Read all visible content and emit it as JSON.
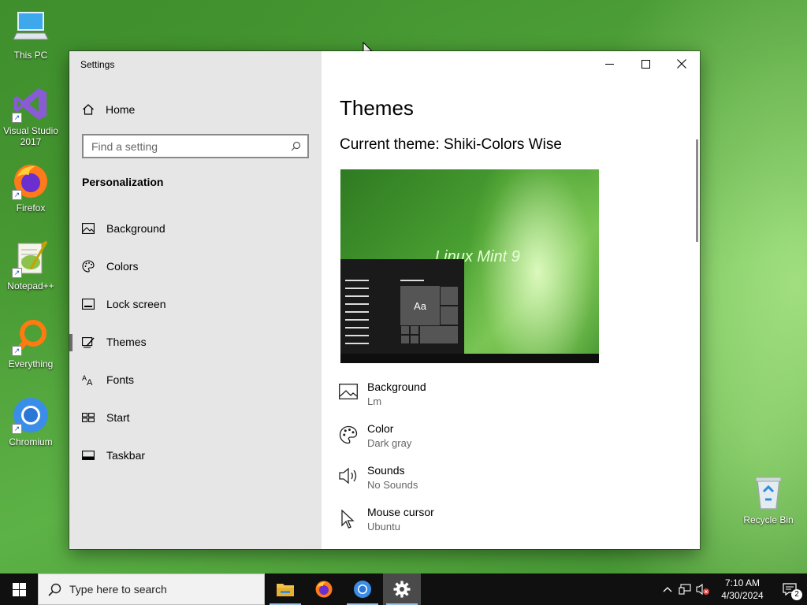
{
  "desktop": {
    "icons": [
      {
        "label": "This PC"
      },
      {
        "label": "Visual Studio 2017"
      },
      {
        "label": "Firefox"
      },
      {
        "label": "Notepad++"
      },
      {
        "label": "Everything"
      },
      {
        "label": "Chromium"
      },
      {
        "label": "Recycle Bin"
      }
    ]
  },
  "window": {
    "title": "Settings",
    "sidebar": {
      "home_label": "Home",
      "search_placeholder": "Find a setting",
      "section": "Personalization",
      "items": [
        {
          "label": "Background",
          "icon": "image-icon"
        },
        {
          "label": "Colors",
          "icon": "palette-icon"
        },
        {
          "label": "Lock screen",
          "icon": "lock-screen-icon"
        },
        {
          "label": "Themes",
          "icon": "themes-icon",
          "selected": true
        },
        {
          "label": "Fonts",
          "icon": "fonts-icon"
        },
        {
          "label": "Start",
          "icon": "start-icon"
        },
        {
          "label": "Taskbar",
          "icon": "taskbar-icon"
        }
      ]
    },
    "content": {
      "title": "Themes",
      "current_theme": "Current theme: Shiki-Colors Wise",
      "preview": {
        "tile_label": "Aa",
        "wallpaper_text": "Linux Mint 9"
      },
      "properties": [
        {
          "name": "Background",
          "value": "Lm",
          "icon": "image-icon"
        },
        {
          "name": "Color",
          "value": "Dark gray",
          "icon": "palette-icon"
        },
        {
          "name": "Sounds",
          "value": "No Sounds",
          "icon": "speaker-icon"
        },
        {
          "name": "Mouse cursor",
          "value": "Ubuntu",
          "icon": "cursor-icon"
        }
      ]
    }
  },
  "taskbar": {
    "search_placeholder": "Type here to search",
    "time": "7:10 AM",
    "date": "4/30/2024",
    "notification_count": "2"
  },
  "colors": {
    "accent": "#9ec2e8",
    "sidebar_bg": "#e6e6e6",
    "taskbar_bg": "#101010"
  }
}
